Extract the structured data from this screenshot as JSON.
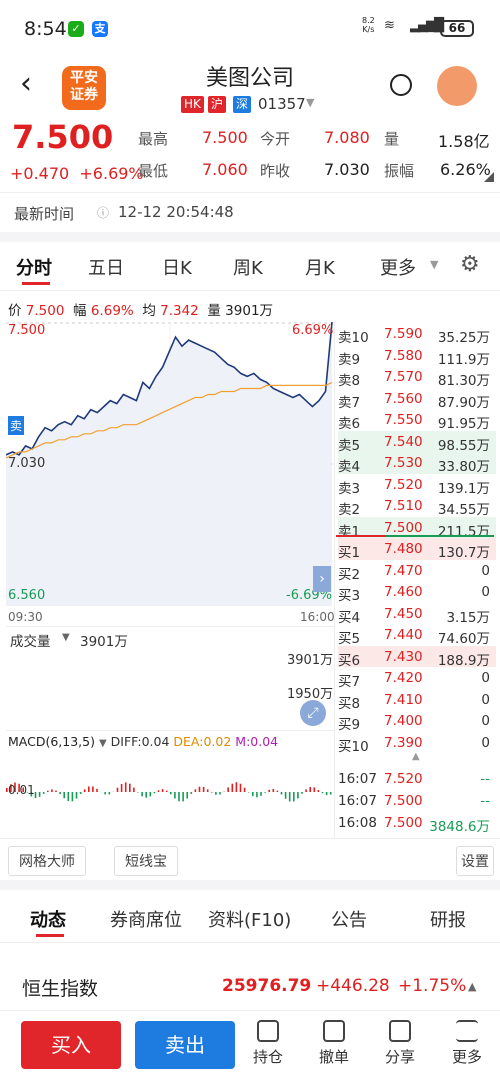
{
  "status_bar": {
    "time": "8:54",
    "net_speed": "8.2",
    "net_unit": "K/s",
    "battery": "66"
  },
  "header": {
    "logo_line1": "平安",
    "logo_line2": "证券",
    "stock_name": "美图公司",
    "tag_hk": "HK",
    "tag_sh": "沪",
    "tag_sz": "深",
    "stock_code": "01357"
  },
  "quote": {
    "price": "7.500",
    "change": "+0.470",
    "change_pct": "+6.69%",
    "high_label": "最高",
    "high": "7.500",
    "open_label": "今开",
    "open": "7.080",
    "vol_label": "量",
    "vol": "1.58亿",
    "low_label": "最低",
    "low": "7.060",
    "prev_label": "昨收",
    "prev": "7.030",
    "amp_label": "振幅",
    "amp": "6.26%",
    "time_label": "最新时间",
    "time": "12-12 20:54:48"
  },
  "tabs": [
    "分时",
    "五日",
    "日K",
    "周K",
    "月K",
    "更多"
  ],
  "chart_info": {
    "price_label": "价",
    "price": "7.500",
    "fu_label": "幅",
    "fu": "6.69%",
    "avg_label": "均",
    "avg": "7.342",
    "liang_label": "量",
    "liang": "3901万"
  },
  "chart_data": {
    "type": "line",
    "title": "",
    "ylim": [
      6.56,
      7.5
    ],
    "y_ticks_left": [
      "7.500",
      "7.030",
      "6.560"
    ],
    "y_ticks_right": [
      "6.69%",
      "-6.69%"
    ],
    "x_ticks": [
      "09:30",
      "16:00"
    ],
    "sell_marker": "卖",
    "series": [
      {
        "name": "",
        "color": "#1f3a7a",
        "values": [
          7.06,
          7.07,
          7.06,
          7.09,
          7.08,
          7.12,
          7.15,
          7.14,
          7.16,
          7.17,
          7.16,
          7.19,
          7.18,
          7.21,
          7.2,
          7.22,
          7.24,
          7.23,
          7.26,
          7.25,
          7.24,
          7.3,
          7.28,
          7.32,
          7.35,
          7.4,
          7.45,
          7.42,
          7.44,
          7.43,
          7.42,
          7.41,
          7.4,
          7.38,
          7.36,
          7.35,
          7.33,
          7.32,
          7.33,
          7.31,
          7.3,
          7.28,
          7.27,
          7.26,
          7.25,
          7.26,
          7.24,
          7.22,
          7.24,
          7.27,
          7.5
        ]
      },
      {
        "name": "",
        "color": "#f0a030",
        "values": [
          7.05,
          7.06,
          7.07,
          7.07,
          7.08,
          7.09,
          7.1,
          7.1,
          7.11,
          7.11,
          7.12,
          7.12,
          7.13,
          7.13,
          7.14,
          7.14,
          7.15,
          7.15,
          7.16,
          7.16,
          7.16,
          7.17,
          7.18,
          7.19,
          7.2,
          7.21,
          7.22,
          7.23,
          7.24,
          7.25,
          7.25,
          7.26,
          7.26,
          7.27,
          7.27,
          7.27,
          7.28,
          7.28,
          7.28,
          7.28,
          7.29,
          7.29,
          7.29,
          7.29,
          7.29,
          7.29,
          7.29,
          7.29,
          7.29,
          7.29,
          7.3
        ]
      }
    ]
  },
  "volume": {
    "label": "成交量",
    "value": "3901万",
    "tick_top": "3901万",
    "tick_mid": "1950万"
  },
  "macd": {
    "label": "MACD(6,13,5)",
    "diff": "DIFF:0.04",
    "dea": "DEA:0.02",
    "m": "M:0.04",
    "tick": "0.01"
  },
  "order_book": {
    "asks": [
      {
        "label": "卖10",
        "price": "7.590",
        "vol": "35.25万"
      },
      {
        "label": "卖9",
        "price": "7.580",
        "vol": "111.9万"
      },
      {
        "label": "卖8",
        "price": "7.570",
        "vol": "81.30万"
      },
      {
        "label": "卖7",
        "price": "7.560",
        "vol": "87.90万"
      },
      {
        "label": "卖6",
        "price": "7.550",
        "vol": "91.95万"
      },
      {
        "label": "卖5",
        "price": "7.540",
        "vol": "98.55万"
      },
      {
        "label": "卖4",
        "price": "7.530",
        "vol": "33.80万"
      },
      {
        "label": "卖3",
        "price": "7.520",
        "vol": "139.1万"
      },
      {
        "label": "卖2",
        "price": "7.510",
        "vol": "34.55万"
      },
      {
        "label": "卖1",
        "price": "7.500",
        "vol": "211.5万"
      }
    ],
    "bids": [
      {
        "label": "买1",
        "price": "7.480",
        "vol": "130.7万"
      },
      {
        "label": "买2",
        "price": "7.470",
        "vol": "0"
      },
      {
        "label": "买3",
        "price": "7.460",
        "vol": "0"
      },
      {
        "label": "买4",
        "price": "7.450",
        "vol": "3.15万"
      },
      {
        "label": "买5",
        "price": "7.440",
        "vol": "74.60万"
      },
      {
        "label": "买6",
        "price": "7.430",
        "vol": "188.9万"
      },
      {
        "label": "买7",
        "price": "7.420",
        "vol": "0"
      },
      {
        "label": "买8",
        "price": "7.410",
        "vol": "0"
      },
      {
        "label": "买9",
        "price": "7.400",
        "vol": "0"
      },
      {
        "label": "买10",
        "price": "7.390",
        "vol": "0"
      }
    ],
    "trades": [
      {
        "time": "16:07",
        "price": "7.520",
        "vol": "--"
      },
      {
        "time": "16:07",
        "price": "7.500",
        "vol": "--"
      },
      {
        "time": "16:08",
        "price": "7.500",
        "vol": "3848.6万"
      }
    ]
  },
  "chips": {
    "grid": "网格大师",
    "short": "短线宝",
    "settings": "设置"
  },
  "bottom_tabs": [
    "动态",
    "券商席位",
    "资料(F10)",
    "公告",
    "研报"
  ],
  "index": {
    "name": "恒生指数",
    "value": "25976.79",
    "change": "+446.28",
    "pct": "+1.75%"
  },
  "actions": {
    "buy": "买入",
    "sell": "卖出",
    "hold": "持仓",
    "cancel": "撤单",
    "share": "分享",
    "more": "更多"
  },
  "colors": {
    "up": "#e02020",
    "down": "#1a9b55",
    "buy_button": "#e0262a",
    "sell_button": "#1e7be0"
  }
}
